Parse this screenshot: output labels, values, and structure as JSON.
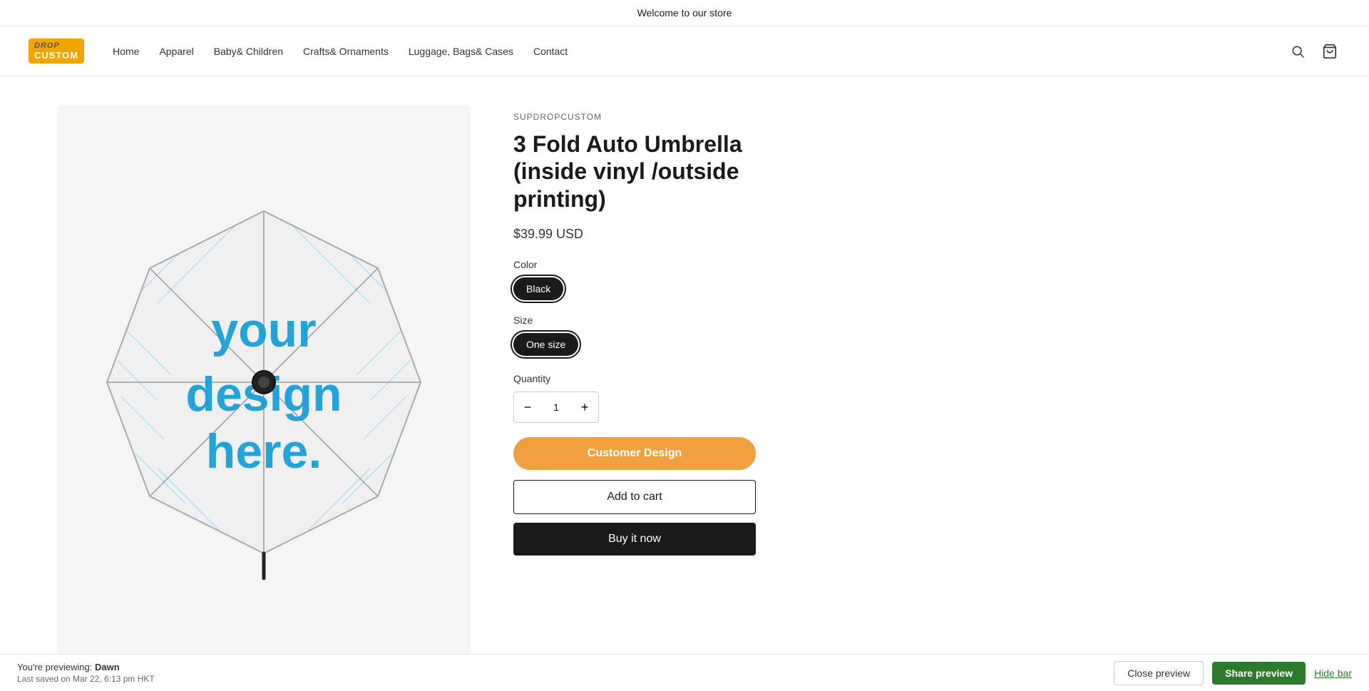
{
  "announcement": {
    "text": "Welcome to our store"
  },
  "header": {
    "logo": {
      "drop": "DROP",
      "custom": "CUSTOM"
    },
    "nav": [
      {
        "label": "Home",
        "href": "#"
      },
      {
        "label": "Apparel",
        "href": "#"
      },
      {
        "label": "Baby& Children",
        "href": "#"
      },
      {
        "label": "Crafts& Ornaments",
        "href": "#"
      },
      {
        "label": "Luggage, Bags& Cases",
        "href": "#"
      },
      {
        "label": "Contact",
        "href": "#"
      }
    ]
  },
  "product": {
    "brand": "SUPDROPCUSTOM",
    "title": "3 Fold Auto Umbrella (inside vinyl /outside printing)",
    "price": "$39.99 USD",
    "color_label": "Color",
    "color_options": [
      {
        "label": "Black",
        "value": "black",
        "active": true
      }
    ],
    "size_label": "Size",
    "size_options": [
      {
        "label": "One size",
        "value": "one-size",
        "active": true
      }
    ],
    "quantity_label": "Quantity",
    "quantity_value": "1",
    "qty_minus": "−",
    "qty_plus": "+",
    "customer_design_btn": "Customer Design",
    "add_to_cart_btn": "Add to cart",
    "buy_now_btn": "Buy it now"
  },
  "preview_bar": {
    "preview_text": "You're previewing:",
    "theme_name": "Dawn",
    "last_saved_label": "Last saved on Mar 22, 6:13 pm HKT",
    "close_btn": "Close preview",
    "share_btn": "Share preview",
    "hide_btn": "Hide bar"
  }
}
